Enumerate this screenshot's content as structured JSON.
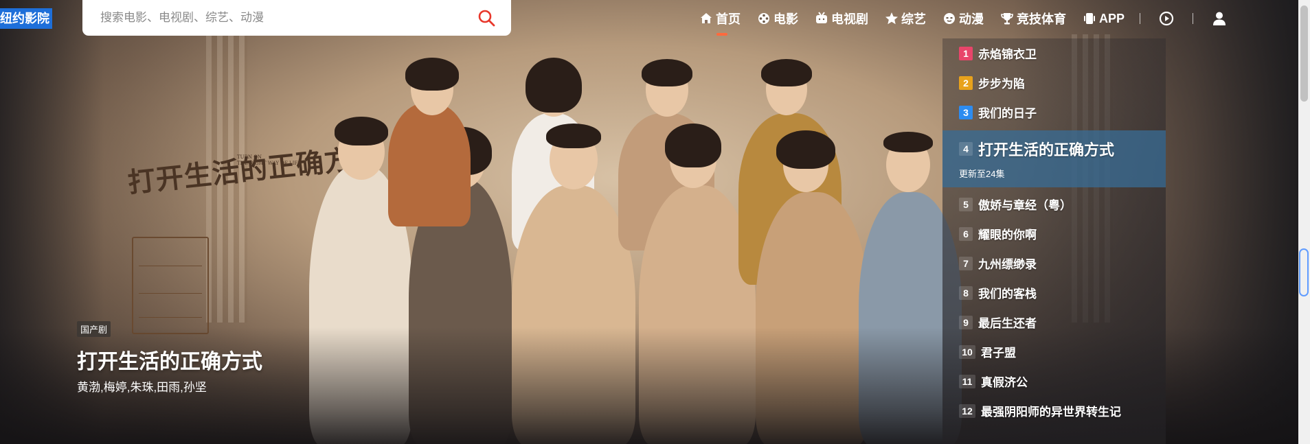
{
  "logo": "纽约影院",
  "search": {
    "placeholder": "搜索电影、电视剧、综艺、动漫"
  },
  "nav": {
    "items": [
      {
        "label": "首页",
        "icon": "home-icon",
        "active": true
      },
      {
        "label": "电影",
        "icon": "film-reel-icon"
      },
      {
        "label": "电视剧",
        "icon": "tv-icon"
      },
      {
        "label": "综艺",
        "icon": "star-icon"
      },
      {
        "label": "动漫",
        "icon": "anime-face-icon"
      },
      {
        "label": "竞技体育",
        "icon": "trophy-icon"
      },
      {
        "label": "APP",
        "icon": "phone-icon"
      }
    ]
  },
  "poster": {
    "art_title": "打开生活的正确方式",
    "art_subtitle_lines": [
      "TURN ON",
      "THE RIGHT WAY OF LIFE"
    ]
  },
  "caption": {
    "tag": "国产剧",
    "title": "打开生活的正确方式",
    "cast": "黄渤,梅婷,朱珠,田雨,孙坚"
  },
  "ranking": [
    {
      "rank": "1",
      "title": "赤焰锦衣卫",
      "color": "#e8456a"
    },
    {
      "rank": "2",
      "title": "步步为陷",
      "color": "#e8a21c"
    },
    {
      "rank": "3",
      "title": "我们的日子",
      "color": "#2d8cf0"
    },
    {
      "rank": "4",
      "title": "打开生活的正确方式",
      "sub": "更新至24集",
      "active": true
    },
    {
      "rank": "5",
      "title": "傲娇与章经（粤）"
    },
    {
      "rank": "6",
      "title": "耀眼的你啊"
    },
    {
      "rank": "7",
      "title": "九州缥缈录"
    },
    {
      "rank": "8",
      "title": "我们的客栈"
    },
    {
      "rank": "9",
      "title": "最后生还者"
    },
    {
      "rank": "10",
      "title": "君子盟"
    },
    {
      "rank": "11",
      "title": "真假济公"
    },
    {
      "rank": "12",
      "title": "最强阴阳师的异世界转生记"
    }
  ]
}
